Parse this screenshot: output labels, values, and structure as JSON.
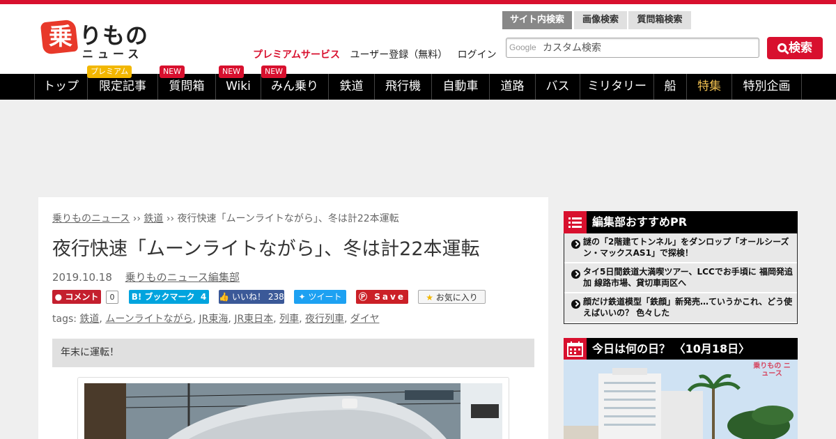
{
  "logo": {
    "kanji": "乗",
    "kana": "りもの",
    "sub": "ニュース"
  },
  "header_links": {
    "premium": "プレミアムサービス",
    "register": "ユーザー登録（無料）",
    "login": "ログイン"
  },
  "search": {
    "tabs": [
      "サイト内検索",
      "画像検索",
      "質問箱検索"
    ],
    "active_tab": "サイト内検索",
    "google_label": "Google",
    "placeholder": "カスタム検索",
    "button_label": "検索"
  },
  "nav": {
    "items": [
      {
        "label": "トップ"
      },
      {
        "label": "限定記事",
        "badge": "プレミアム"
      },
      {
        "label": "質問箱",
        "badge": "NEW"
      },
      {
        "label": "Wiki",
        "badge": "NEW"
      },
      {
        "label": "みん乗り",
        "badge": "NEW"
      },
      {
        "label": "鉄道"
      },
      {
        "label": "飛行機"
      },
      {
        "label": "自動車"
      },
      {
        "label": "道路"
      },
      {
        "label": "バス"
      },
      {
        "label": "ミリタリー"
      },
      {
        "label": "船"
      },
      {
        "label": "特集"
      },
      {
        "label": "特別企画"
      }
    ]
  },
  "article": {
    "breadcrumb": {
      "home": "乗りものニュース",
      "sep": "››",
      "category": "鉄道",
      "current": "夜行快速「ムーンライトながら」、冬は計22本運転"
    },
    "title": "夜行快速「ムーンライトながら」、冬は計22本運転",
    "date": "2019.10.18",
    "author": "乗りものニュース編集部",
    "share": {
      "comment_label": "コメント",
      "comment_count": "0",
      "hatena_label": "B! ブックマーク",
      "hatena_count": "4",
      "like_label": "いいね！",
      "like_count": "238",
      "tweet_label": "ツイート",
      "save_label": "Save",
      "fav_label": "お気に入り"
    },
    "tags_label": "tags:",
    "tags": [
      "鉄道",
      "ムーンライトながら",
      "JR東海",
      "JR東日本",
      "列車",
      "夜行列車",
      "ダイヤ"
    ],
    "lead": "年末に運転！"
  },
  "sidebar": {
    "pr_heading": "編集部おすすめPR",
    "pr_items": [
      "謎の「2階建てトンネル」をダンロップ「オールシーズン・マックスAS1」で探検！",
      "タイ5日間鉄道大満喫ツアー、LCCでお手頃に 福岡発追加 線路市場、貸切車両区へ",
      "顔だけ鉄道模型「鉄顔」新発売…ていうかこれ、どう使えばいいの？ 色々した"
    ],
    "today_heading": "今日は何の日？ 〈10月18日〉",
    "watermark": "乗りもの ニュース"
  }
}
